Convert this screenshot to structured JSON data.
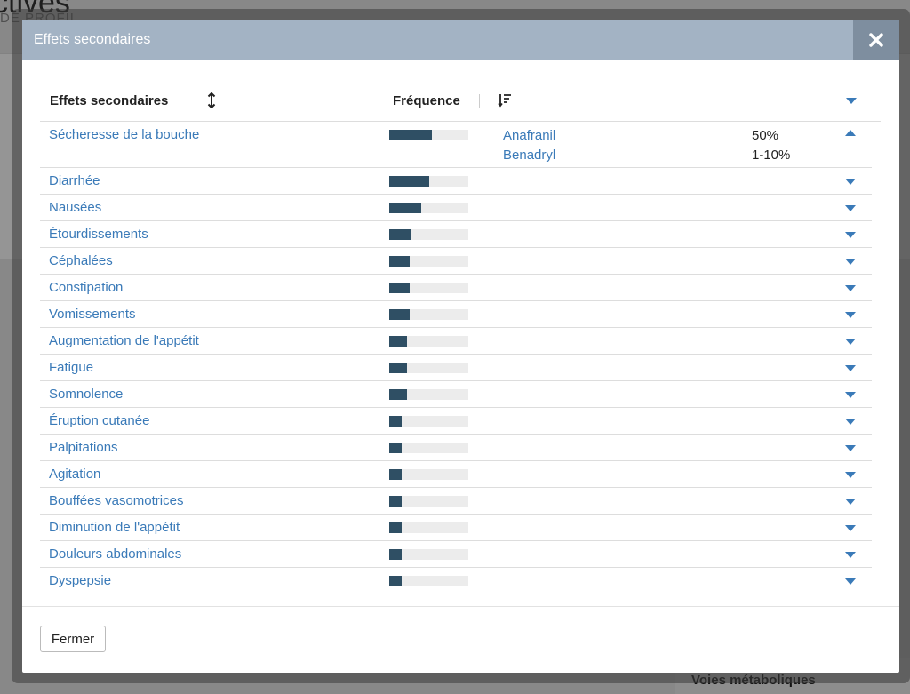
{
  "background": {
    "title": "ctives",
    "subtitle": "DE PROFIL",
    "bottom_title": "Voies métaboliques"
  },
  "modal": {
    "title": "Effets secondaires",
    "close_icon": "close-icon",
    "columns": {
      "effect": "Effets secondaires",
      "frequency": "Fréquence"
    },
    "rows": [
      {
        "label": "Sécheresse de la bouche",
        "level": 0.54,
        "expanded": true,
        "drugs": [
          {
            "name": "Anafranil",
            "freq": "50%"
          },
          {
            "name": "Benadryl",
            "freq": "1-10%"
          }
        ]
      },
      {
        "label": "Diarrhée",
        "level": 0.5
      },
      {
        "label": "Nausées",
        "level": 0.4
      },
      {
        "label": "Étourdissements",
        "level": 0.28
      },
      {
        "label": "Céphalées",
        "level": 0.26
      },
      {
        "label": "Constipation",
        "level": 0.26
      },
      {
        "label": "Vomissements",
        "level": 0.26
      },
      {
        "label": "Augmentation de l'appétit",
        "level": 0.22
      },
      {
        "label": "Fatigue",
        "level": 0.22
      },
      {
        "label": "Somnolence",
        "level": 0.22
      },
      {
        "label": "Éruption cutanée",
        "level": 0.16
      },
      {
        "label": "Palpitations",
        "level": 0.16
      },
      {
        "label": "Agitation",
        "level": 0.16
      },
      {
        "label": "Bouffées vasomotrices",
        "level": 0.16
      },
      {
        "label": "Diminution de l'appétit",
        "level": 0.16
      },
      {
        "label": "Douleurs abdominales",
        "level": 0.16
      },
      {
        "label": "Dyspepsie",
        "level": 0.16
      }
    ],
    "footer": {
      "close_label": "Fermer"
    }
  },
  "colors": {
    "header": "#a3b3c4",
    "link": "#3a7ab8",
    "bar": "#2f4f64"
  }
}
